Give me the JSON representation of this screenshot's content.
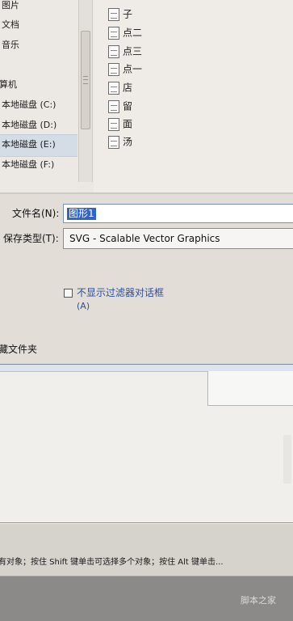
{
  "nav_pane": {
    "items": [
      {
        "label": "图片"
      },
      {
        "label": "文档"
      },
      {
        "label": "音乐"
      },
      {
        "label": "计算机"
      },
      {
        "label": "本地磁盘 (C:)"
      },
      {
        "label": "本地磁盘 (D:)"
      },
      {
        "label": "本地磁盘 (E:)"
      },
      {
        "label": "本地磁盘 (F:)"
      }
    ]
  },
  "file_list": {
    "items": [
      {
        "label": "子",
        "icon": "file-icon"
      },
      {
        "label": "点二",
        "icon": "file-icon"
      },
      {
        "label": "点三",
        "icon": "file-icon"
      },
      {
        "label": "点一",
        "icon": "file-icon"
      },
      {
        "label": "店",
        "icon": "file-icon"
      },
      {
        "label": "留",
        "icon": "file-icon"
      },
      {
        "label": "面",
        "icon": "file-icon"
      },
      {
        "label": "汤",
        "icon": "file-icon"
      }
    ]
  },
  "form": {
    "filename_label": "文件名(N):",
    "filename_value": "图形1",
    "filetype_label": "保存类型(T):",
    "filetype_value": "SVG - Scalable Vector Graphics",
    "checkbox_label": "不显示过滤器对话框",
    "checkbox_shortcut": "(A)",
    "checkbox_checked": false,
    "folder_label": "藏文件夹"
  },
  "status_bar": {
    "text": "有对象；按住 Shift 键单击可选择多个对象；按住 Alt 键单击..."
  },
  "watermark": "脚本之家",
  "colors": {
    "selection": "#3065c8",
    "link_blue": "#2d4f9a"
  }
}
